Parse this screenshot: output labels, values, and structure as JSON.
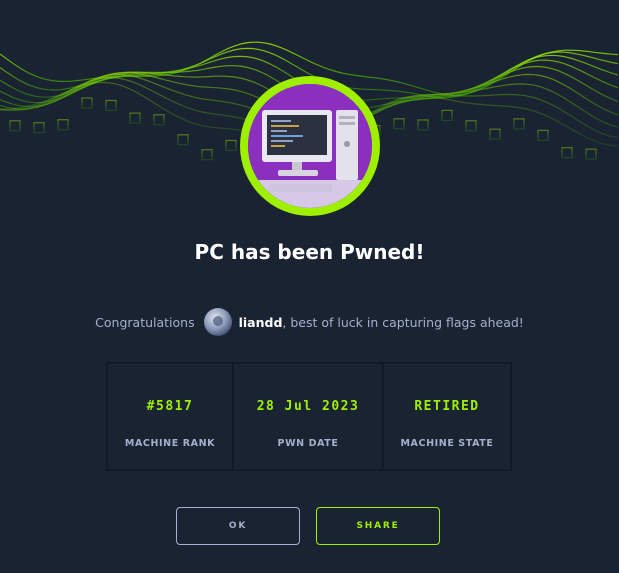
{
  "dialog": {
    "title": "PC has been Pwned!",
    "congrats_prefix": "Congratulations",
    "username": "liandd",
    "congrats_suffix": ", best of luck in capturing flags ahead!"
  },
  "stats": [
    {
      "value": "#5817",
      "label": "MACHINE RANK"
    },
    {
      "value": "28 Jul 2023",
      "label": "PWN DATE"
    },
    {
      "value": "RETIRED",
      "label": "MACHINE STATE"
    }
  ],
  "buttons": {
    "ok_label": "OK",
    "share_label": "SHARE"
  },
  "colors": {
    "accent": "#9fef00",
    "background": "#1a2332",
    "text_muted": "#a4b1cd",
    "machine_avatar_bg": "#8b2fbe"
  },
  "icons": {
    "machine_avatar": "computer-workstation-icon",
    "user_avatar": "user-avatar"
  }
}
